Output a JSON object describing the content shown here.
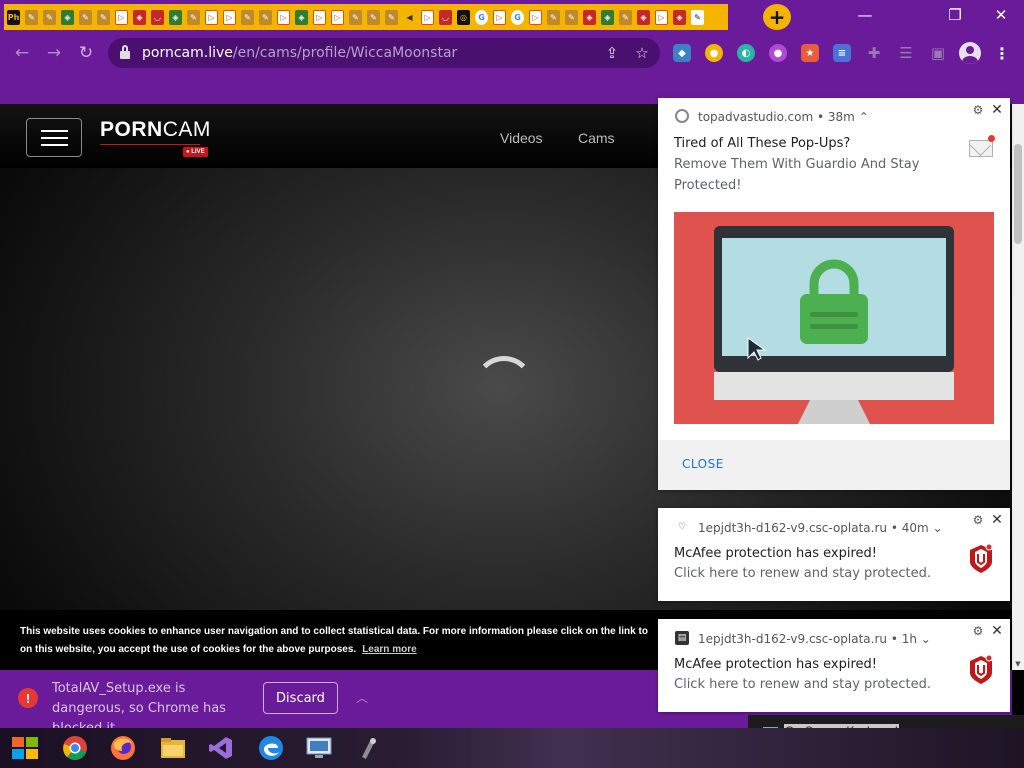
{
  "browser": {
    "tabs": [
      {
        "icon": "pornhub-tab-icon",
        "glyph": "Ph",
        "style": "t-hub"
      },
      {
        "icon": "hand-tab-icon",
        "glyph": "✎",
        "style": "t-hand"
      },
      {
        "icon": "hand-tab-icon",
        "glyph": "✎",
        "style": "t-hand"
      },
      {
        "icon": "shield-tab-icon",
        "glyph": "◈",
        "style": "t-shield"
      },
      {
        "icon": "hand-tab-icon",
        "glyph": "✎",
        "style": "t-hand"
      },
      {
        "icon": "hand-tab-icon",
        "glyph": "✎",
        "style": "t-hand"
      },
      {
        "icon": "play-tab-icon",
        "glyph": "▷",
        "style": "t-play"
      },
      {
        "icon": "shield-tab-icon",
        "glyph": "◈",
        "style": "t-red"
      },
      {
        "icon": "tray-tab-icon",
        "glyph": "◡",
        "style": "t-red"
      },
      {
        "icon": "shield-tab-icon",
        "glyph": "◈",
        "style": "t-shield"
      },
      {
        "icon": "hand-tab-icon",
        "glyph": "✎",
        "style": "t-hand"
      },
      {
        "icon": "play-tab-icon",
        "glyph": "▷",
        "style": "t-play"
      },
      {
        "icon": "play-tab-icon",
        "glyph": "▷",
        "style": "t-play"
      },
      {
        "icon": "hand-tab-icon",
        "glyph": "✎",
        "style": "t-hand"
      },
      {
        "icon": "hand-tab-icon",
        "glyph": "✎",
        "style": "t-hand"
      },
      {
        "icon": "play-tab-icon",
        "glyph": "▷",
        "style": "t-play"
      },
      {
        "icon": "shield-tab-icon",
        "glyph": "◈",
        "style": "t-shield"
      },
      {
        "icon": "play-tab-icon",
        "glyph": "▷",
        "style": "t-play"
      },
      {
        "icon": "play-tab-icon",
        "glyph": "▷",
        "style": "t-play"
      },
      {
        "icon": "hand-tab-icon",
        "glyph": "✎",
        "style": "t-hand"
      },
      {
        "icon": "hand-tab-icon",
        "glyph": "✎",
        "style": "t-hand"
      },
      {
        "icon": "hand-tab-icon",
        "glyph": "✎",
        "style": "t-hand"
      },
      {
        "icon": "speaker-tab-icon",
        "glyph": "◀",
        "style": "t-sound"
      },
      {
        "icon": "play-tab-icon",
        "glyph": "▷",
        "style": "t-play"
      },
      {
        "icon": "tray-tab-icon",
        "glyph": "◡",
        "style": "t-red"
      },
      {
        "icon": "target-tab-icon",
        "glyph": "◎",
        "style": "t-hub"
      },
      {
        "icon": "google-tab-icon",
        "glyph": "G",
        "style": "t-g"
      },
      {
        "icon": "play-tab-icon",
        "glyph": "▷",
        "style": "t-play"
      },
      {
        "icon": "google-tab-icon",
        "glyph": "G",
        "style": "t-g"
      },
      {
        "icon": "play-tab-icon",
        "glyph": "▷",
        "style": "t-play"
      },
      {
        "icon": "hand-tab-icon",
        "glyph": "✎",
        "style": "t-hand"
      },
      {
        "icon": "hand-tab-icon",
        "glyph": "✎",
        "style": "t-hand"
      },
      {
        "icon": "shield-tab-icon",
        "glyph": "◈",
        "style": "t-red"
      },
      {
        "icon": "shield-tab-icon",
        "glyph": "◈",
        "style": "t-shield"
      },
      {
        "icon": "hand-tab-icon",
        "glyph": "✎",
        "style": "t-hand"
      },
      {
        "icon": "shield-tab-icon",
        "glyph": "◈",
        "style": "t-red"
      },
      {
        "icon": "play-tab-icon",
        "glyph": "▷",
        "style": "t-play"
      },
      {
        "icon": "shield-tab-icon",
        "glyph": "◈",
        "style": "t-red"
      },
      {
        "icon": "hand-tab-icon",
        "glyph": "✎",
        "style": "t-active"
      }
    ],
    "new_tab_icon": "plus-icon",
    "window_controls": [
      "minimize-icon",
      "restore-icon",
      "close-icon"
    ],
    "url_host": "porncam.live",
    "url_path": "/en/cams/profile/WiccaMoonstar",
    "extensions": [
      "extension-icon",
      "extension-icon",
      "extension-icon",
      "extension-icon",
      "extension-icon",
      "extension-icon",
      "puzzle-icon",
      "reading-list-icon",
      "side-panel-icon"
    ],
    "theme_color": "#6a1b9a"
  },
  "site": {
    "logo_porn": "PORN",
    "logo_cam": "CAM",
    "live_badge": "● LIVE",
    "nav": [
      "Videos",
      "Cams"
    ],
    "cookie_text": "This website uses cookies to enhance user navigation and to collect statistical data. For more information please click on the link to",
    "cookie_text_2": "on this website, you accept the use of cookies for the above purposes.",
    "learn_more": "Learn more",
    "accent_color": "#c4161c"
  },
  "download_bar": {
    "message": "TotalAV_Setup.exe is dangerous, so Chrome has blocked it.",
    "discard_label": "Discard"
  },
  "notifications": [
    {
      "source": "topadvastudio.com",
      "age": "38m",
      "title": "Tired of All These Pop-Ups?",
      "body": "Remove Them With Guardio And Stay Protected!",
      "action": "CLOSE"
    },
    {
      "source": "1epjdt3h-d162-v9.csc-oplata.ru",
      "age": "40m",
      "title": "McAfee protection has expired!",
      "body": "Click here to renew and stay protected."
    },
    {
      "source": "1epjdt3h-d162-v9.csc-oplata.ru",
      "age": "1h",
      "title": "McAfee protection has expired!",
      "body": "Click here to renew and stay protected."
    }
  ],
  "taskbar": {
    "apps": [
      "start-icon",
      "chrome-icon",
      "firefox-icon",
      "file-explorer-icon",
      "visual-studio-icon",
      "edge-icon",
      "remote-desktop-icon",
      "app-icon"
    ],
    "osk_label": "On-Screen Keyboard"
  }
}
